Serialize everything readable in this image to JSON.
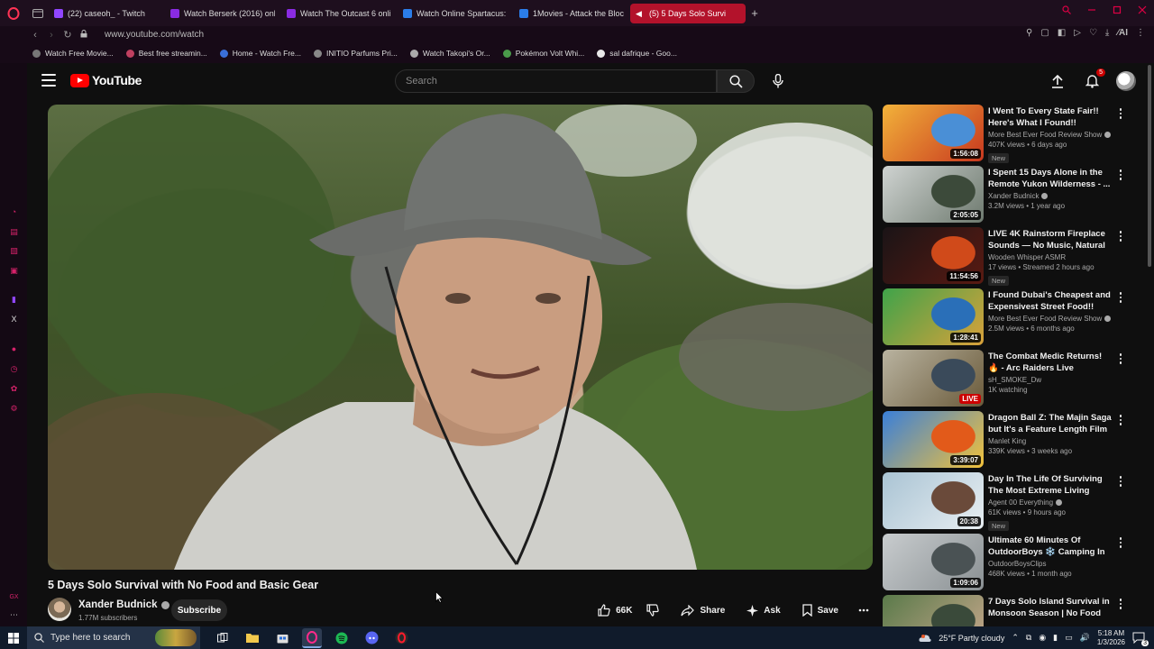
{
  "browser": {
    "tabs": [
      {
        "label": "(22) caseoh_ - Twitch",
        "color": "#9146ff"
      },
      {
        "label": "Watch Berserk (2016) onli",
        "color": "#8a2be2"
      },
      {
        "label": "Watch The Outcast 6 onlin",
        "color": "#8a2be2"
      },
      {
        "label": "Watch Online Spartacus: I",
        "color": "#2b7de9"
      },
      {
        "label": "1Movies - Attack the Block",
        "color": "#2b7de9"
      },
      {
        "label": "(5) 5 Days Solo Survi",
        "color": "#ffffff",
        "active": true
      }
    ],
    "url": "www.youtube.com/watch",
    "ai_label": "AI",
    "bookmarks": [
      {
        "label": "Watch Free Movie...",
        "color": "#777777"
      },
      {
        "label": "Best free streamin...",
        "color": "#c04060"
      },
      {
        "label": "Home - Watch Fre...",
        "color": "#3a6fd8"
      },
      {
        "label": "INITIO Parfums Pri...",
        "color": "#888888"
      },
      {
        "label": "Watch Takopi's Or...",
        "color": "#aaaaaa"
      },
      {
        "label": "Pokémon Volt Whi...",
        "color": "#4a9a4a"
      },
      {
        "label": "sal dafrique - Goo...",
        "color": "#e8e8e8"
      }
    ]
  },
  "youtube": {
    "logo_text": "YouTube",
    "search_placeholder": "Search",
    "notification_count": "5",
    "video": {
      "title": "5 Days Solo Survival with No Food and Basic Gear",
      "channel": "Xander Budnick",
      "subscribers": "1.77M subscribers",
      "subscribe_label": "Subscribe",
      "likes": "66K",
      "share_label": "Share",
      "ask_label": "Ask",
      "save_label": "Save"
    },
    "recommendations": [
      {
        "title": "I Went To Every State Fair!! Here's What I Found!!",
        "channel": "More Best Ever Food Review Show",
        "verified": true,
        "meta": "407K views • 6 days ago",
        "badge": "New",
        "duration": "1:56:08",
        "live": false,
        "thumb": [
          "#f2b23a",
          "#c8381f",
          "#4a8fd6"
        ]
      },
      {
        "title": "I Spent 15 Days Alone in the Remote Yukon Wilderness - ...",
        "channel": "Xander Budnick",
        "verified": true,
        "meta": "3.2M views • 1 year ago",
        "badge": "",
        "duration": "2:05:05",
        "live": false,
        "thumb": [
          "#cfd3d1",
          "#6e7a6f",
          "#3c4a3a"
        ]
      },
      {
        "title": "LIVE 4K Rainstorm Fireplace Sounds — No Music, Natural ...",
        "channel": "Wooden Whisper ASMR",
        "verified": false,
        "meta": "17 views • Streamed 2 hours ago",
        "badge": "New",
        "duration": "11:54:56",
        "live": false,
        "thumb": [
          "#1a1416",
          "#5a1a12",
          "#d04a1a"
        ]
      },
      {
        "title": "I Found Dubai's Cheapest and Expensivest Street Food!!",
        "channel": "More Best Ever Food Review Show",
        "verified": true,
        "meta": "2.5M views • 6 months ago",
        "badge": "",
        "duration": "1:28:41",
        "live": false,
        "thumb": [
          "#3fa34a",
          "#d9a13a",
          "#2a6fb8"
        ]
      },
      {
        "title": "The Combat Medic Returns! 🔥 - Arc Raiders Live",
        "channel": "sH_SMOKE_Dw",
        "verified": false,
        "meta": "1K watching",
        "badge": "",
        "duration": "LIVE",
        "live": true,
        "thumb": [
          "#b9b3a0",
          "#6a5a3a",
          "#3a4a5a"
        ]
      },
      {
        "title": "Dragon Ball Z: The Majin Saga but It's a Feature Length Film ...",
        "channel": "Manlet King",
        "verified": false,
        "meta": "339K views • 3 weeks ago",
        "badge": "",
        "duration": "3:39:07",
        "live": false,
        "thumb": [
          "#3a7fd9",
          "#f2c23a",
          "#e25a1a"
        ]
      },
      {
        "title": "Day In The Life Of Surviving The Most Extreme Living Condition...",
        "channel": "Agent 00 Everything",
        "verified": true,
        "meta": "61K views • 9 hours ago",
        "badge": "New",
        "duration": "20:38",
        "live": false,
        "thumb": [
          "#aac4d4",
          "#e8eef2",
          "#6a4a3a"
        ]
      },
      {
        "title": "Ultimate 60 Minutes Of OutdoorBoys ❄️ Camping In ...",
        "channel": "OutdoorBoysClips",
        "verified": false,
        "meta": "468K views • 1 month ago",
        "badge": "",
        "duration": "1:09:06",
        "live": false,
        "thumb": [
          "#c8ccce",
          "#8a9093",
          "#4a5254"
        ]
      },
      {
        "title": "7 Days Solo Island Survival in Monsoon Season | No Food",
        "channel": "",
        "verified": false,
        "meta": "",
        "badge": "",
        "duration": "",
        "live": false,
        "thumb": [
          "#5a7a4a",
          "#c9a88d",
          "#3a4a3a"
        ]
      }
    ]
  },
  "taskbar": {
    "search_placeholder": "Type here to search",
    "weather": "25°F  Partly cloudy",
    "time": "5:18 AM",
    "date": "1/3/2026",
    "notif_count": "3"
  }
}
